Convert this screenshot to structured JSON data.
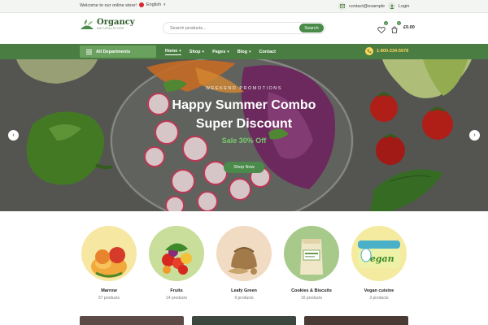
{
  "topbar": {
    "welcome": "Welcome to our online store!",
    "language": "English",
    "contact": "contact@example",
    "login": "Login"
  },
  "header": {
    "logo_name": "Organcy",
    "logo_tagline": "NATURALSTORE",
    "search_placeholder": "Search products...",
    "search_button": "Search",
    "wishlist_count": "0",
    "cart_count": "0",
    "cart_total": "£0.00"
  },
  "nav": {
    "departments": "All Departments",
    "items": [
      {
        "label": "Home",
        "active": true,
        "dropdown": true
      },
      {
        "label": "Shop",
        "dropdown": true
      },
      {
        "label": "Pages",
        "dropdown": true
      },
      {
        "label": "Blog",
        "dropdown": true
      },
      {
        "label": "Contact",
        "dropdown": false
      }
    ],
    "phone": "1-800-234-5678"
  },
  "hero": {
    "subtitle": "WEEKEND PROMOTIONS",
    "title_line1": "Happy Summer Combo",
    "title_line2": "Super Discount",
    "sale": "Sale 30% Off",
    "button": "Shop Now"
  },
  "categories": [
    {
      "name": "Marrow",
      "count": "37 products",
      "bg": "#f6e7a3"
    },
    {
      "name": "Fruits",
      "count": "14 products",
      "bg": "#c8de9a"
    },
    {
      "name": "Leafy Green",
      "count": "9 products",
      "bg": "#f1dbc2"
    },
    {
      "name": "Cookies & Biscuits",
      "count": "16 products",
      "bg": "#a7c98a"
    },
    {
      "name": "Vegan cuisine",
      "count": "3 products",
      "bg": "#f4eba0"
    }
  ],
  "colors": {
    "brand_green": "#4a7d42",
    "accent_green": "#4a8a4a",
    "sale_green": "#7bc96f",
    "phone_yellow": "#ffd65a"
  }
}
